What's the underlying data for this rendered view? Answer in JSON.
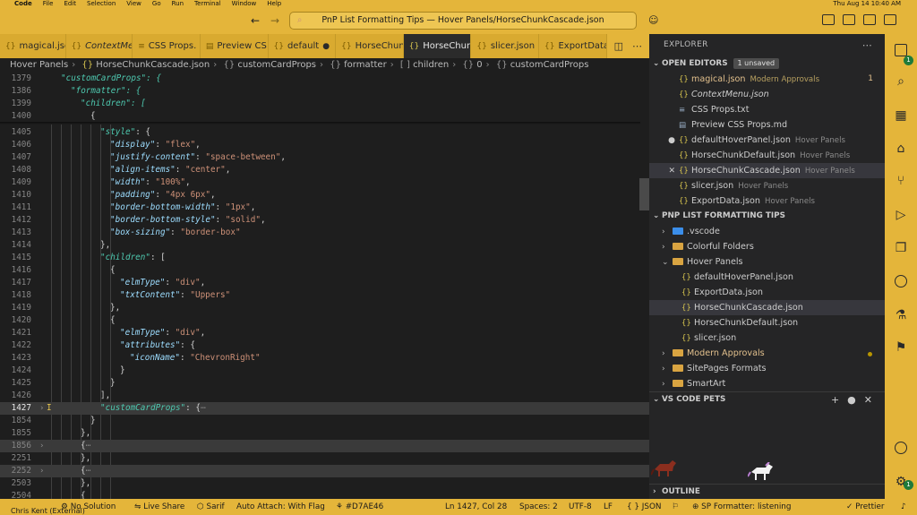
{
  "menubar": {
    "app": "Code",
    "items": [
      "File",
      "Edit",
      "Selection",
      "View",
      "Go",
      "Run",
      "Terminal",
      "Window",
      "Help"
    ],
    "clock": "Thu Aug 14  10:40 AM"
  },
  "titlebar": {
    "command_center": "PnP List Formatting Tips — Hover Panels/HorseChunkCascade.json"
  },
  "tabs": [
    {
      "label": "magical.json",
      "italic": false
    },
    {
      "label": "ContextMe",
      "italic": true
    },
    {
      "label": "CSS Props.",
      "italic": false
    },
    {
      "label": "Preview CS",
      "italic": false
    },
    {
      "label": "default",
      "italic": false,
      "dirty": true
    },
    {
      "label": "HorseChun",
      "italic": false
    },
    {
      "label": "HorseChun",
      "italic": false,
      "active": true
    },
    {
      "label": "slicer.json",
      "italic": false
    },
    {
      "label": "ExportData",
      "italic": false
    }
  ],
  "breadcrumb": [
    "Hover Panels",
    "HorseChunkCascade.json",
    "customCardProps",
    "formatter",
    "children",
    "0",
    "customCardProps"
  ],
  "editor": {
    "sticky": [
      {
        "ln": "1379",
        "ind": 2,
        "text": "\"customCardProps\": {"
      },
      {
        "ln": "1386",
        "ind": 3,
        "text": "\"formatter\": {"
      },
      {
        "ln": "1399",
        "ind": 4,
        "text": "\"children\": ["
      },
      {
        "ln": "1400",
        "ind": 5,
        "text": "{"
      }
    ],
    "lines": [
      {
        "ln": "1405",
        "ind": 6,
        "k": "\"style\"",
        "rest": ": {"
      },
      {
        "ln": "1406",
        "ind": 7,
        "k": "\"display\"",
        "rest": ": ",
        "v": "\"flex\"",
        "end": ","
      },
      {
        "ln": "1407",
        "ind": 7,
        "k": "\"justify-content\"",
        "rest": ": ",
        "v": "\"space-between\"",
        "end": ","
      },
      {
        "ln": "1408",
        "ind": 7,
        "k": "\"align-items\"",
        "rest": ": ",
        "v": "\"center\"",
        "end": ","
      },
      {
        "ln": "1409",
        "ind": 7,
        "k": "\"width\"",
        "rest": ": ",
        "v": "\"100%\"",
        "end": ","
      },
      {
        "ln": "1410",
        "ind": 7,
        "k": "\"padding\"",
        "rest": ": ",
        "v": "\"4px 6px\"",
        "end": ","
      },
      {
        "ln": "1411",
        "ind": 7,
        "k": "\"border-bottom-width\"",
        "rest": ": ",
        "v": "\"1px\"",
        "end": ","
      },
      {
        "ln": "1412",
        "ind": 7,
        "k": "\"border-bottom-style\"",
        "rest": ": ",
        "v": "\"solid\"",
        "end": ","
      },
      {
        "ln": "1413",
        "ind": 7,
        "k": "\"box-sizing\"",
        "rest": ": ",
        "v": "\"border-box\""
      },
      {
        "ln": "1414",
        "ind": 6,
        "rest": "},"
      },
      {
        "ln": "1415",
        "ind": 6,
        "k": "\"children\"",
        "rest": ": ["
      },
      {
        "ln": "1416",
        "ind": 7,
        "rest": "{"
      },
      {
        "ln": "1417",
        "ind": 8,
        "k": "\"elmType\"",
        "rest": ": ",
        "v": "\"div\"",
        "end": ","
      },
      {
        "ln": "1418",
        "ind": 8,
        "k": "\"txtContent\"",
        "rest": ": ",
        "v": "\"Uppers\""
      },
      {
        "ln": "1419",
        "ind": 7,
        "rest": "},"
      },
      {
        "ln": "1420",
        "ind": 7,
        "rest": "{"
      },
      {
        "ln": "1421",
        "ind": 8,
        "k": "\"elmType\"",
        "rest": ": ",
        "v": "\"div\"",
        "end": ","
      },
      {
        "ln": "1422",
        "ind": 8,
        "k": "\"attributes\"",
        "rest": ": {"
      },
      {
        "ln": "1423",
        "ind": 9,
        "k": "\"iconName\"",
        "rest": ": ",
        "v": "\"ChevronRight\""
      },
      {
        "ln": "1424",
        "ind": 8,
        "rest": "}"
      },
      {
        "ln": "1425",
        "ind": 7,
        "rest": "}"
      },
      {
        "ln": "1426",
        "ind": 6,
        "rest": "],"
      },
      {
        "ln": "1427",
        "ind": 6,
        "k": "\"customCardProps\"",
        "rest": ": {",
        "fold": true,
        "folded": true,
        "current": true
      },
      {
        "ln": "1854",
        "ind": 5,
        "rest": "}"
      },
      {
        "ln": "1855",
        "ind": 4,
        "rest": "},"
      },
      {
        "ln": "1856",
        "ind": 4,
        "rest": "{",
        "fold": true,
        "folded": true
      },
      {
        "ln": "2251",
        "ind": 4,
        "rest": "},"
      },
      {
        "ln": "2252",
        "ind": 4,
        "rest": "{",
        "fold": true,
        "folded": true
      },
      {
        "ln": "2503",
        "ind": 4,
        "rest": "},"
      },
      {
        "ln": "2504",
        "ind": 4,
        "rest": "{"
      }
    ]
  },
  "explorer": {
    "title": "EXPLORER",
    "open_editors_label": "OPEN EDITORS",
    "unsaved_badge": "1 unsaved",
    "open_editors": [
      {
        "name": "magical.json",
        "desc": "Modern Approvals",
        "mod": "1",
        "warn": true,
        "icon": "{}"
      },
      {
        "name": "ContextMenu.json",
        "italic": true,
        "icon": "{}"
      },
      {
        "name": "CSS Props.txt",
        "icon": "≡"
      },
      {
        "name": "Preview CSS Props.md",
        "icon": "▤"
      },
      {
        "name": "defaultHoverPanel.json",
        "desc": "Hover Panels",
        "dirty": true,
        "icon": "{}"
      },
      {
        "name": "HorseChunkDefault.json",
        "desc": "Hover Panels",
        "icon": "{}"
      },
      {
        "name": "HorseChunkCascade.json",
        "desc": "Hover Panels",
        "selected": true,
        "close": true,
        "icon": "{}"
      },
      {
        "name": "slicer.json",
        "desc": "Hover Panels",
        "icon": "{}"
      },
      {
        "name": "ExportData.json",
        "desc": "Hover Panels",
        "icon": "{}"
      }
    ],
    "workspace_label": "PNP LIST FORMATTING TIPS",
    "tree": [
      {
        "name": ".vscode",
        "type": "folder-closed",
        "vscode": true
      },
      {
        "name": "Colorful Folders",
        "type": "folder-closed"
      },
      {
        "name": "Hover Panels",
        "type": "folder-open"
      },
      {
        "name": "defaultHoverPanel.json",
        "type": "file"
      },
      {
        "name": "ExportData.json",
        "type": "file"
      },
      {
        "name": "HorseChunkCascade.json",
        "type": "file",
        "selected": true
      },
      {
        "name": "HorseChunkDefault.json",
        "type": "file"
      },
      {
        "name": "slicer.json",
        "type": "file"
      },
      {
        "name": "Modern Approvals",
        "type": "folder-closed",
        "warn": true
      },
      {
        "name": "SitePages Formats",
        "type": "folder-closed"
      },
      {
        "name": "SmartArt",
        "type": "folder-closed"
      }
    ],
    "pets_label": "VS CODE PETS",
    "outline_label": "OUTLINE"
  },
  "statusbar": {
    "remote": "Chris Kent (External)",
    "solution": "No Solution",
    "live_share": "Live Share",
    "sarif": "Sarif",
    "auto_attach": "Auto Attach: With Flag",
    "color": "#D7AE46",
    "position": "Ln 1427, Col 28",
    "spaces": "Spaces: 2",
    "encoding": "UTF-8",
    "eol": "LF",
    "language": "JSON",
    "formatter": "SP Formatter: listening",
    "prettier": "Prettier"
  },
  "colors": {
    "theme_accent": "#e4b53a",
    "editor_bg": "#1e1e1e",
    "sidebar_bg": "#252526"
  }
}
